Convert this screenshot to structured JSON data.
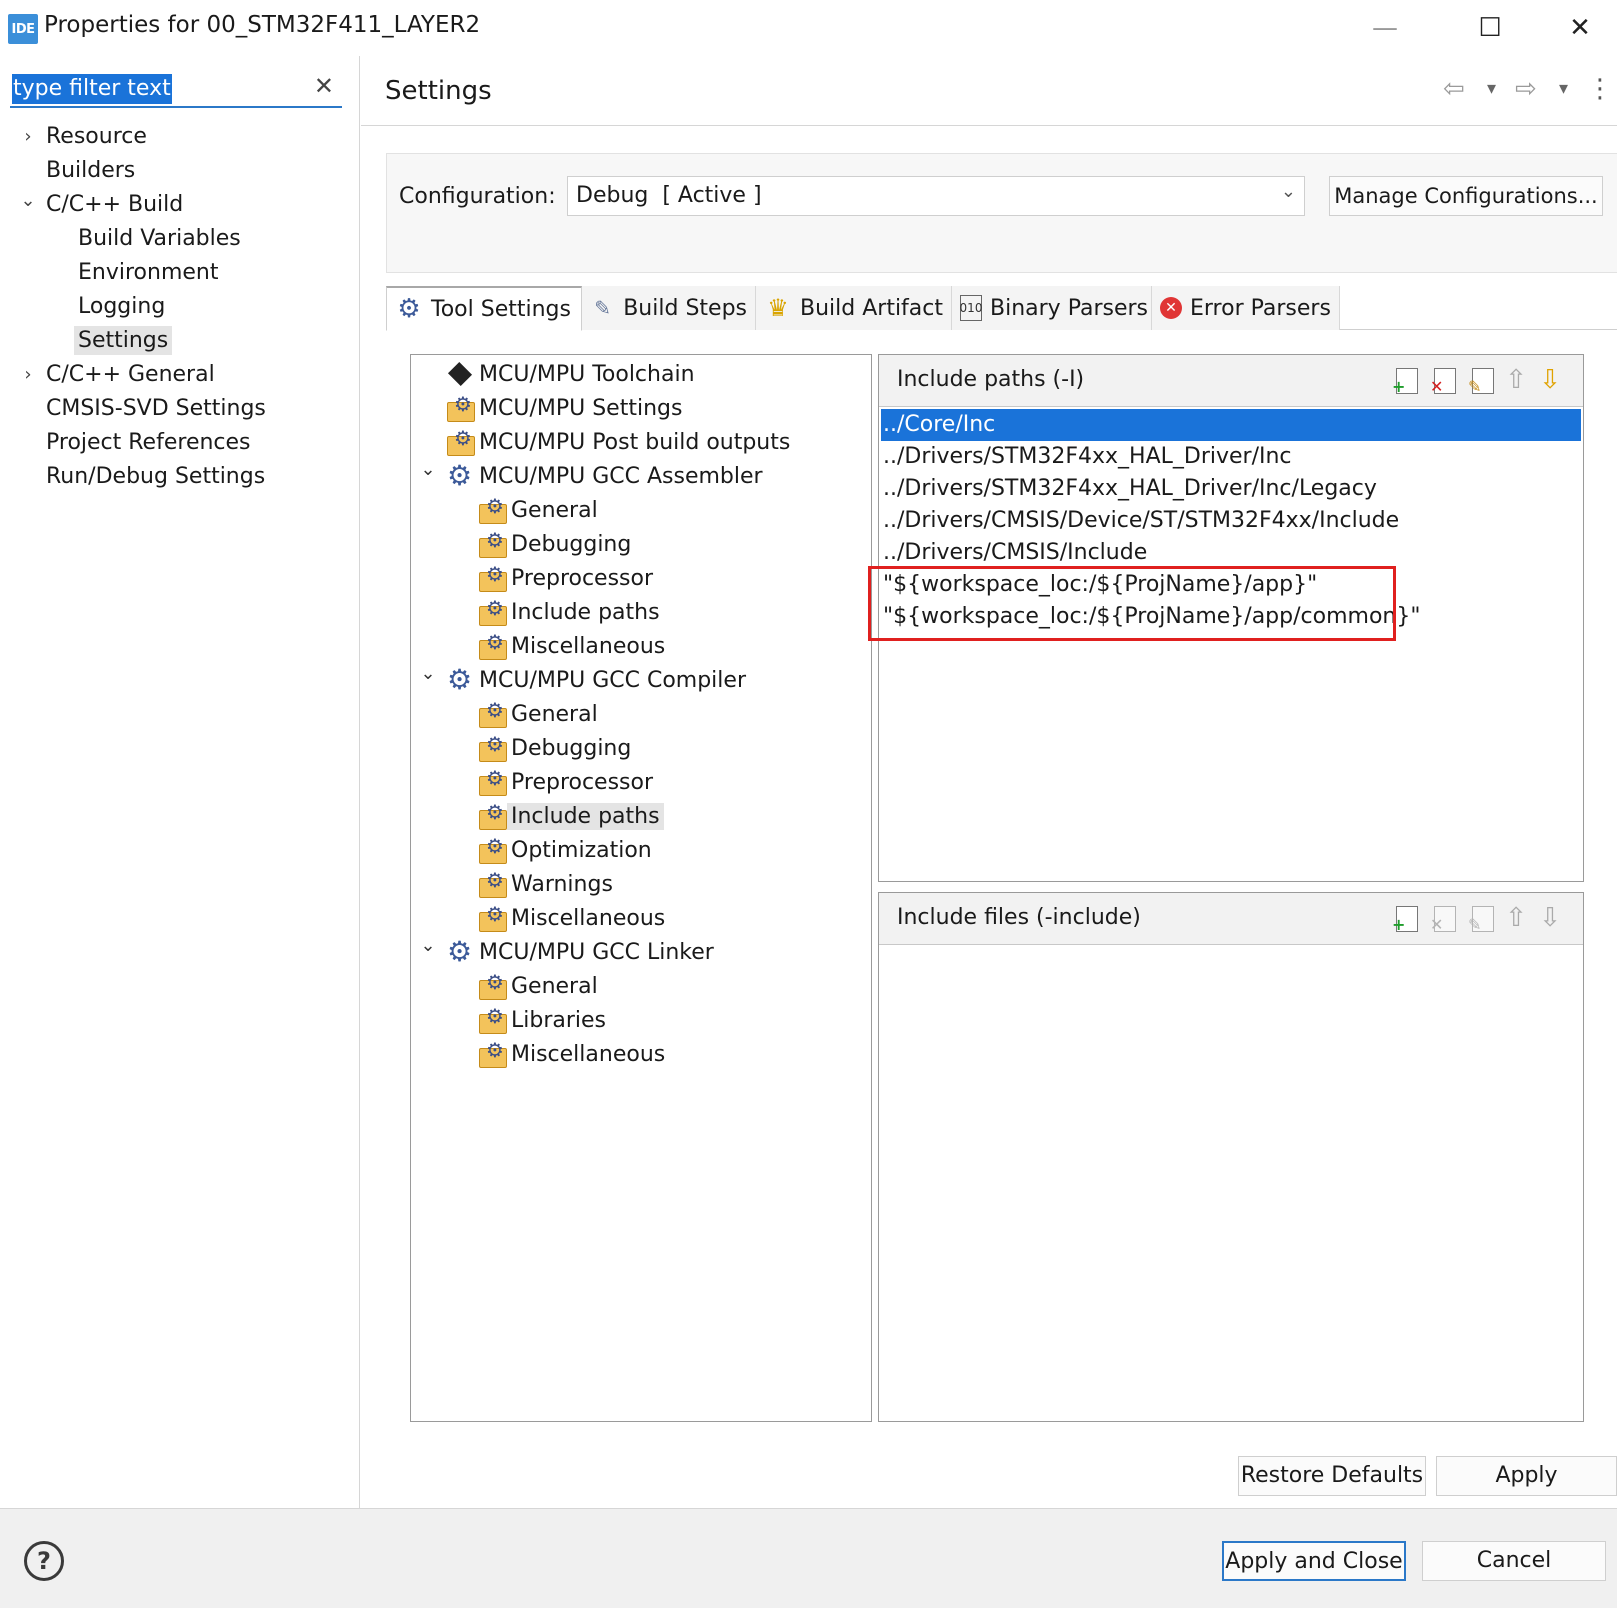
{
  "window": {
    "app_icon": "IDE",
    "title": "Properties for 00_STM32F411_LAYER2",
    "minimize": "—",
    "maximize": "☐",
    "close": "✕"
  },
  "filter": {
    "text": "type filter text",
    "clear": "✕"
  },
  "nav": [
    {
      "label": "Resource",
      "chevron": "›"
    },
    {
      "label": "Builders"
    },
    {
      "label": "C/C++ Build",
      "chevron": "⌄"
    },
    {
      "label": "Build Variables"
    },
    {
      "label": "Environment"
    },
    {
      "label": "Logging"
    },
    {
      "label": "Settings",
      "selected": true
    },
    {
      "label": "C/C++ General",
      "chevron": "›"
    },
    {
      "label": "CMSIS-SVD Settings"
    },
    {
      "label": "Project References"
    },
    {
      "label": "Run/Debug Settings"
    }
  ],
  "page": {
    "title": "Settings",
    "back_icon": "⇦",
    "forward_icon": "⇨",
    "dropdown_icon": "▾",
    "menu_icon": "⋮"
  },
  "config": {
    "label": "Configuration:",
    "value": "Debug  [ Active ]",
    "caret": "⌄",
    "manage_button": "Manage Configurations..."
  },
  "tabs": [
    {
      "label": "Tool Settings",
      "icon": "tool-settings-icon",
      "active": true
    },
    {
      "label": "Build Steps",
      "icon": "build-steps-icon"
    },
    {
      "label": "Build Artifact",
      "icon": "trophy-icon"
    },
    {
      "label": "Binary Parsers",
      "icon": "binary-icon"
    },
    {
      "label": "Error Parsers",
      "icon": "error-icon"
    }
  ],
  "tree": [
    {
      "label": "MCU/MPU Toolchain",
      "icon": "chip"
    },
    {
      "label": "MCU/MPU Settings",
      "icon": "folder"
    },
    {
      "label": "MCU/MPU Post build outputs",
      "icon": "folder"
    },
    {
      "label": "MCU/MPU GCC Assembler",
      "icon": "gear",
      "chevron": "⌄"
    },
    {
      "label": "General",
      "icon": "folder"
    },
    {
      "label": "Debugging",
      "icon": "folder"
    },
    {
      "label": "Preprocessor",
      "icon": "folder"
    },
    {
      "label": "Include paths",
      "icon": "folder"
    },
    {
      "label": "Miscellaneous",
      "icon": "folder"
    },
    {
      "label": "MCU/MPU GCC Compiler",
      "icon": "gear",
      "chevron": "⌄"
    },
    {
      "label": "General",
      "icon": "folder"
    },
    {
      "label": "Debugging",
      "icon": "folder"
    },
    {
      "label": "Preprocessor",
      "icon": "folder"
    },
    {
      "label": "Include paths",
      "icon": "folder",
      "selected": true
    },
    {
      "label": "Optimization",
      "icon": "folder"
    },
    {
      "label": "Warnings",
      "icon": "folder"
    },
    {
      "label": "Miscellaneous",
      "icon": "folder"
    },
    {
      "label": "MCU/MPU GCC Linker",
      "icon": "gear",
      "chevron": "⌄"
    },
    {
      "label": "General",
      "icon": "folder"
    },
    {
      "label": "Libraries",
      "icon": "folder"
    },
    {
      "label": "Miscellaneous",
      "icon": "folder"
    }
  ],
  "include_paths": {
    "title": "Include paths (-I)",
    "items": [
      "../Core/Inc",
      "../Drivers/STM32F4xx_HAL_Driver/Inc",
      "../Drivers/STM32F4xx_HAL_Driver/Inc/Legacy",
      "../Drivers/CMSIS/Device/ST/STM32F4xx/Include",
      "../Drivers/CMSIS/Include",
      "\"${workspace_loc:/${ProjName}/app}\"",
      "\"${workspace_loc:/${ProjName}/app/common}\""
    ],
    "selected_index": 0,
    "highlight_color": "#e0201f"
  },
  "include_files": {
    "title": "Include files (-include)",
    "items": []
  },
  "toolbar_badges": {
    "add": "+",
    "delete": "✕",
    "edit": "✎",
    "up": "⇧",
    "down": "⇩"
  },
  "buttons": {
    "restore_defaults": "Restore Defaults",
    "apply": "Apply",
    "apply_and_close": "Apply and Close",
    "cancel": "Cancel",
    "help": "?"
  },
  "colors": {
    "selection": "#1a73d9",
    "highlight_box": "#e0201f"
  }
}
